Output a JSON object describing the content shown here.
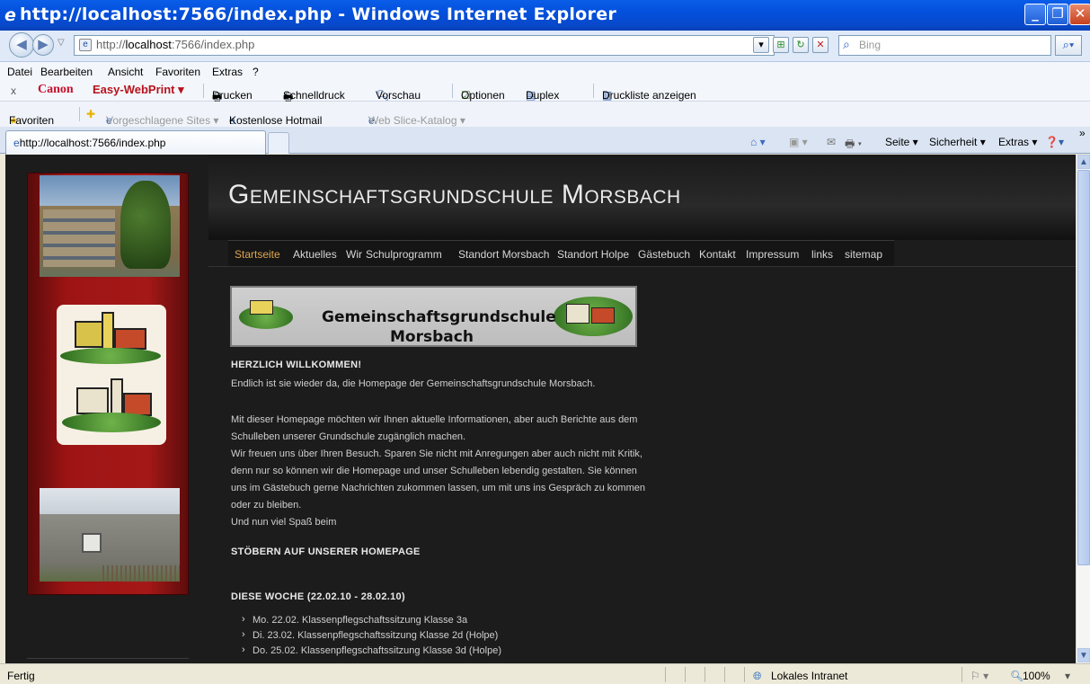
{
  "window": {
    "title": "http://localhost:7566/index.php - Windows Internet Explorer"
  },
  "address": {
    "url_prefix": "http://",
    "url_host": "localhost",
    "url_rest": ":7566/index.php",
    "search_placeholder": "Bing"
  },
  "menu": [
    "Datei",
    "Bearbeiten",
    "Ansicht",
    "Favoriten",
    "Extras",
    "?"
  ],
  "canon_toolbar": {
    "close": "x",
    "brand": "Canon",
    "product": "Easy-WebPrint ▾",
    "items": [
      "Drucken",
      "Schnelldruck",
      "Vorschau",
      "Optionen",
      "Duplex",
      "Druckliste anzeigen"
    ]
  },
  "favorites_bar": {
    "favorites": "Favoriten",
    "suggested": "Vorgeschlagene Sites ▾",
    "hotmail": "Kostenlose Hotmail",
    "webslice": "Web Slice-Katalog ▾"
  },
  "tab": {
    "label": "http://localhost:7566/index.php"
  },
  "command_bar": {
    "page": "Seite ▾",
    "security": "Sicherheit ▾",
    "extras": "Extras ▾",
    "more": "»"
  },
  "site": {
    "title": "Gemeinschaftsgrundschule Morsbach",
    "nav": [
      "Startseite",
      "Aktuelles",
      "Wir",
      "Schulprogramm",
      "Standort Morsbach",
      "Standort Holpe",
      "Gästebuch",
      "Kontakt",
      "Impressum",
      "links",
      "sitemap"
    ],
    "banner": {
      "line1": "Gemeinschaftsgrundschule",
      "line2": "Morsbach"
    },
    "welcome_heading": "HERZLICH WILLKOMMEN!",
    "paragraphs": [
      "Endlich ist sie wieder da, die Homepage der Gemeinschaftsgrundschule Morsbach.",
      "Mit dieser Homepage möchten wir Ihnen aktuelle Informationen, aber auch Berichte aus dem",
      "Schulleben unserer Grundschule zugänglich machen.",
      "Wir freuen uns über Ihren Besuch. Sparen Sie nicht mit Anregungen aber auch nicht mit Kritik,",
      "denn nur so können wir die Homepage und unser Schulleben lebendig gestalten. Sie können",
      "uns im Gästebuch gerne Nachrichten zukommen lassen, um mit uns ins Gespräch zu kommen",
      "oder zu bleiben.",
      "Und nun viel Spaß beim"
    ],
    "browse_heading": "STÖBERN AUF UNSERER HOMEPAGE",
    "week_heading": "DIESE WOCHE (22.02.10 - 28.02.10)",
    "week_items": [
      "Mo. 22.02. Klassenpflegschaftssitzung Klasse 3a",
      "Di. 23.02. Klassenpflegschaftssitzung Klasse 2d (Holpe)",
      "Do. 25.02. Klassenpflegschaftssitzung Klasse 3d (Holpe)"
    ]
  },
  "status": {
    "text": "Fertig",
    "zone": "Lokales Intranet",
    "zoom": "100%"
  }
}
